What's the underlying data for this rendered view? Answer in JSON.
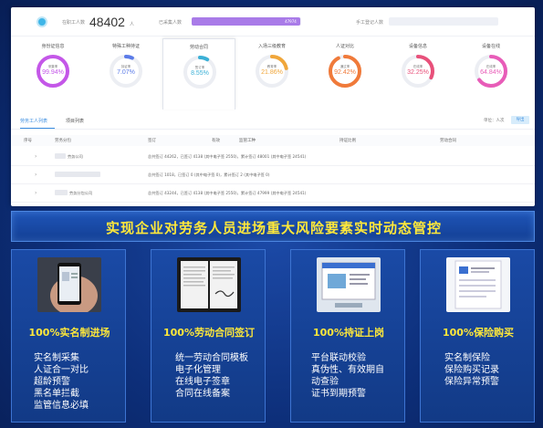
{
  "header": {
    "total_label": "在职工人数",
    "total_count": "48402",
    "total_unit": "人",
    "collected_label": "已采集人数",
    "collected_value": "47974",
    "collected_fraction": 0.99,
    "manual_label": "手工登记人数",
    "manual_fraction": 0.0
  },
  "cards": [
    {
      "title": "身份证信息",
      "sub": "采集率",
      "value": "99.94%",
      "fraction": 0.9994,
      "color": "#c457e8",
      "active": false
    },
    {
      "title": "特殊工种持证",
      "sub": "持证率",
      "value": "7.07%",
      "fraction": 0.0707,
      "color": "#5b7be8",
      "active": false
    },
    {
      "title": "劳动合同",
      "sub": "签订率",
      "value": "8.55%",
      "fraction": 0.0855,
      "color": "#3bb0d6",
      "active": true
    },
    {
      "title": "入场三级教育",
      "sub": "教育率",
      "value": "21.86%",
      "fraction": 0.2186,
      "color": "#f0a63a",
      "active": false
    },
    {
      "title": "人证对比",
      "sub": "通过率",
      "value": "92.42%",
      "fraction": 0.9242,
      "color": "#f07a3a",
      "active": false
    },
    {
      "title": "设备信息",
      "sub": "在线率",
      "value": "32.25%",
      "fraction": 0.3225,
      "color": "#e8507a",
      "active": false
    },
    {
      "title": "设备在线",
      "sub": "在线率",
      "value": "64.84%",
      "fraction": 0.6484,
      "color": "#e85cb8",
      "active": false
    }
  ],
  "tabs": {
    "tab1": "劳务工人列表",
    "tab2": "项目列表",
    "unit": "单位：人次",
    "export": "导出"
  },
  "table": {
    "headers": [
      "序号",
      "劳务分包",
      "签订",
      "有效",
      "监管工种",
      "持证比例",
      "劳动合同"
    ],
    "rows": [
      {
        "name": "劳务公司",
        "detail": "总共签订 44262，已签订 4138 (其中电子签 2550)，累计签订 48001 (其中电子签 24541)"
      },
      {
        "name": "",
        "detail": "总共签订 1018，已签订 0 (其中电子签 0)，累计签订 2 (其中电子签 0)"
      },
      {
        "name": "劳务分包公司",
        "detail": "总共签订 43244，已签订 4138 (其中电子签 2550)，累计签订 47999 (其中电子签 24541)"
      }
    ]
  },
  "banner": {
    "text": "实现企业对劳务人员进场重大风险要素实时动态管控"
  },
  "features": [
    {
      "title": "100%实名制进场",
      "items": [
        "实名制采集",
        "人证合一对比",
        "超龄预警",
        "黑名单拦截",
        "监管信息必填"
      ]
    },
    {
      "title": "100%劳动合同签订",
      "items": [
        "统一劳动合同模板",
        "电子化管理",
        "在线电子签章",
        "合同在线备案"
      ]
    },
    {
      "title": "100%持证上岗",
      "items": [
        "平台联动校验",
        "真伪性、有效期自",
        "动查验",
        "证书到期预警"
      ]
    },
    {
      "title": "100%保险购买",
      "items": [
        "实名制保险",
        "保险购买记录",
        "保险异常预警"
      ]
    }
  ]
}
